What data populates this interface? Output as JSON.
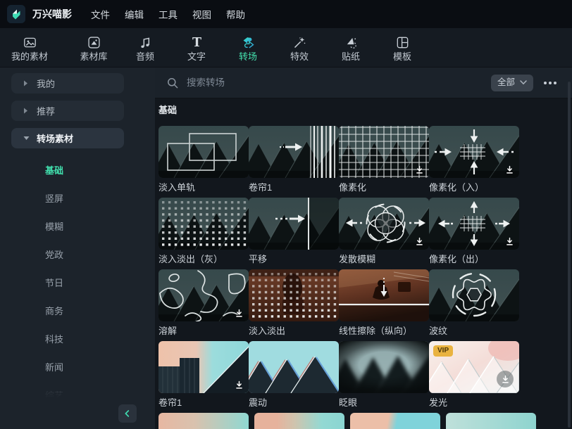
{
  "window": {
    "title": "万兴喵影"
  },
  "menubar": {
    "items": [
      "文件",
      "编辑",
      "工具",
      "视图",
      "帮助"
    ]
  },
  "tabbar": {
    "tabs": [
      {
        "label": "我的素材",
        "icon": "my-media-icon",
        "active": false
      },
      {
        "label": "素材库",
        "icon": "stock-media-icon",
        "active": false
      },
      {
        "label": "音频",
        "icon": "audio-icon",
        "active": false
      },
      {
        "label": "文字",
        "icon": "text-icon",
        "active": false
      },
      {
        "label": "转场",
        "icon": "transition-icon",
        "active": true
      },
      {
        "label": "特效",
        "icon": "effects-icon",
        "active": false
      },
      {
        "label": "贴纸",
        "icon": "sticker-icon",
        "active": false
      },
      {
        "label": "模板",
        "icon": "template-icon",
        "active": false
      }
    ]
  },
  "sidebar": {
    "groups": [
      {
        "label": "我的",
        "state": "collapsed",
        "active": false
      },
      {
        "label": "推荐",
        "state": "collapsed",
        "active": false
      },
      {
        "label": "转场素材",
        "state": "expanded",
        "active": true
      }
    ],
    "categories": [
      {
        "label": "基础",
        "active": true,
        "faded": false
      },
      {
        "label": "竖屏",
        "active": false,
        "faded": false
      },
      {
        "label": "模糊",
        "active": false,
        "faded": false
      },
      {
        "label": "党政",
        "active": false,
        "faded": false
      },
      {
        "label": "节日",
        "active": false,
        "faded": false
      },
      {
        "label": "商务",
        "active": false,
        "faded": false
      },
      {
        "label": "科技",
        "active": false,
        "faded": false
      },
      {
        "label": "新闻",
        "active": false,
        "faded": false
      },
      {
        "label": "综艺",
        "active": false,
        "faded": true
      }
    ]
  },
  "toolbar": {
    "search_placeholder": "搜索转场",
    "filter_label": "全部"
  },
  "section": {
    "title": "基础"
  },
  "badges": {
    "vip_label": "VIP"
  },
  "grid": {
    "items": [
      {
        "label": "淡入单轨",
        "base": "houses",
        "overlay": "rects",
        "download": false,
        "vip": false
      },
      {
        "label": "卷帘1",
        "base": "houses",
        "overlay": "vlines",
        "download": false,
        "vip": false
      },
      {
        "label": "像素化",
        "base": "houses",
        "overlay": "grid",
        "download": true,
        "vip": false
      },
      {
        "label": "像素化（入）",
        "base": "houses",
        "overlay": "arrows-in",
        "download": true,
        "vip": false
      },
      {
        "label": "淡入淡出（灰）",
        "base": "houses",
        "overlay": "dots",
        "download": false,
        "vip": false
      },
      {
        "label": "平移",
        "base": "houses",
        "overlay": "pan",
        "download": false,
        "vip": false
      },
      {
        "label": "发散模糊",
        "base": "houses",
        "overlay": "circles",
        "download": true,
        "vip": false
      },
      {
        "label": "像素化（出）",
        "base": "houses",
        "overlay": "arrows-out",
        "download": true,
        "vip": false
      },
      {
        "label": "溶解",
        "base": "houses",
        "overlay": "waves",
        "download": true,
        "vip": false
      },
      {
        "label": "淡入淡出",
        "base": "brown",
        "overlay": "dots",
        "download": false,
        "vip": false
      },
      {
        "label": "线性擦除（纵向）",
        "base": "skatepark",
        "overlay": "wipe-down",
        "download": false,
        "vip": false
      },
      {
        "label": "波纹",
        "base": "houses",
        "overlay": "ripple",
        "download": false,
        "vip": false
      },
      {
        "label": "卷帘1",
        "base": "colorful",
        "overlay": "none",
        "download": true,
        "vip": false
      },
      {
        "label": "震动",
        "base": "rgbshift",
        "overlay": "none",
        "download": false,
        "vip": false
      },
      {
        "label": "眨眼",
        "base": "blur",
        "overlay": "none",
        "download": false,
        "vip": false
      },
      {
        "label": "发光",
        "base": "glow",
        "overlay": "none",
        "download": true,
        "download_style": "circle",
        "vip": true
      }
    ]
  },
  "partial_next_row": {
    "items": [
      {
        "style": "pink-cyan"
      },
      {
        "style": "pink-cyan-soft"
      },
      {
        "style": "pink-cyan-split"
      },
      {
        "style": "cyan"
      }
    ]
  },
  "icons": {
    "search": "magnifier",
    "filter_chevron": "chevron-down",
    "more": "horizontal-ellipsis",
    "group_collapsed": "caret-right",
    "group_expanded": "caret-down",
    "download": "download-arrow",
    "collapse": "chevron-left"
  },
  "colors": {
    "accent": "#45e0ad",
    "vip": "#e9b340",
    "menubar_bg": "#0a0d12",
    "tabbar_bg": "#151b22",
    "sidebar_bg": "#1c232b",
    "content_bg": "#12171d"
  }
}
